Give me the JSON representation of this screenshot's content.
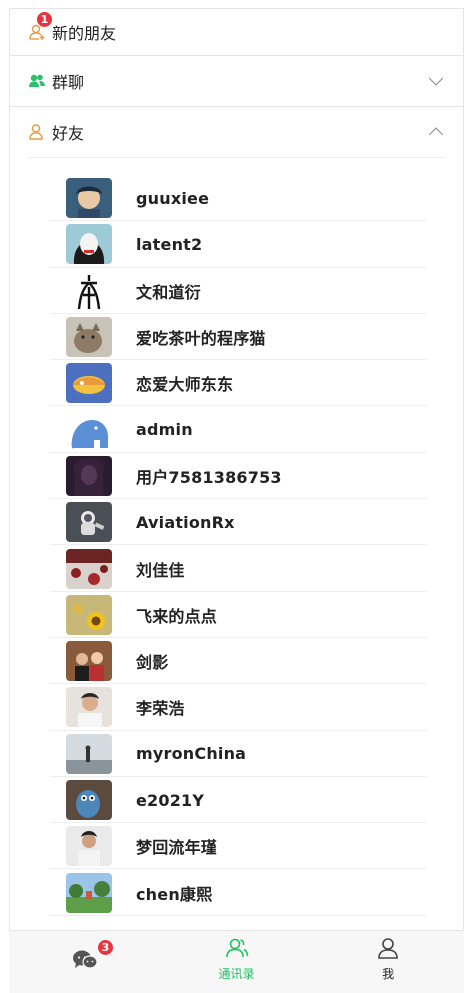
{
  "header": {
    "new_friends_label": "新的朋友",
    "new_friends_badge": "1",
    "groups_label": "群聊",
    "friends_label": "好友"
  },
  "friends": [
    {
      "name": "guuxiee",
      "avatar": "cartoon-boy"
    },
    {
      "name": "latent2",
      "avatar": "cartoon-girl"
    },
    {
      "name": "文和道衍",
      "avatar": "ancient-character"
    },
    {
      "name": "爱吃茶叶的程序猫",
      "avatar": "cat-photo"
    },
    {
      "name": "恋爱大师东东",
      "avatar": "cartoon-food"
    },
    {
      "name": "admin",
      "avatar": "blue-elephant"
    },
    {
      "name": "用户7581386753",
      "avatar": "dark-portrait"
    },
    {
      "name": "AviationRx",
      "avatar": "astronaut"
    },
    {
      "name": "刘佳佳",
      "avatar": "red-scene"
    },
    {
      "name": "飞来的点点",
      "avatar": "sunflower"
    },
    {
      "name": "剑影",
      "avatar": "couple-photo"
    },
    {
      "name": "李荣浩",
      "avatar": "man-portrait"
    },
    {
      "name": "myronChina",
      "avatar": "landscape-photo"
    },
    {
      "name": "e2021Y",
      "avatar": "toy-figure"
    },
    {
      "name": "梦回流年瑾",
      "avatar": "man-photo"
    },
    {
      "name": "chen康熙",
      "avatar": "park-photo"
    }
  ],
  "tabbar": {
    "chats_badge": "3",
    "contacts_label": "通讯录",
    "me_label": "我"
  },
  "colors": {
    "accent_green": "#1ec15f",
    "badge_red": "#e8343e",
    "orange_icon": "#e89a3c",
    "group_icon_green": "#2bbf6a"
  }
}
